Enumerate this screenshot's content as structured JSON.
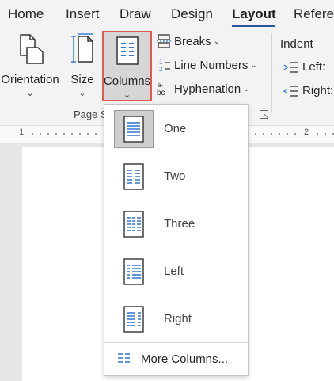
{
  "tabs": [
    "Home",
    "Insert",
    "Draw",
    "Design",
    "Layout",
    "Referen"
  ],
  "active_tab": "Layout",
  "ribbon": {
    "orientation_label": "Orientation",
    "size_label": "Size",
    "columns_label": "Columns",
    "breaks_label": "Breaks",
    "line_numbers_label": "Line Numbers",
    "hyphenation_label": "Hyphenation",
    "group_label": "Page S",
    "indent_title": "Indent",
    "indent_left_label": "Left:",
    "indent_right_label": "Right:"
  },
  "ruler": {
    "marks": [
      "1",
      "2"
    ]
  },
  "columns_menu": {
    "items": [
      "One",
      "Two",
      "Three",
      "Left",
      "Right"
    ],
    "selected": "One",
    "more_label": "More Columns..."
  },
  "colors": {
    "accent_blue": "#2b579a",
    "highlight_red": "#e05a4e",
    "icon_blue": "#3b7dd8"
  }
}
